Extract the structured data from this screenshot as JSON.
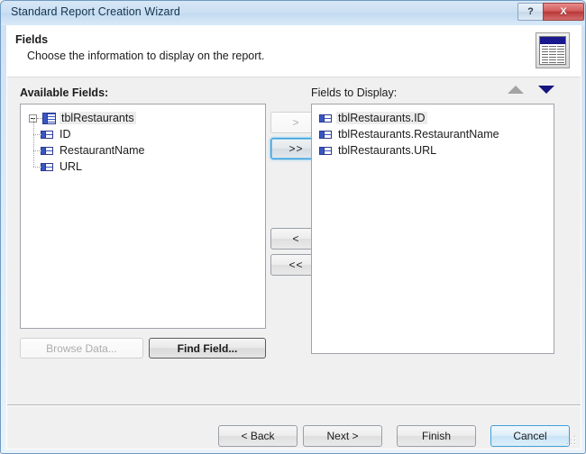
{
  "window": {
    "title": "Standard Report Creation Wizard",
    "help_button": "?",
    "close_button": "X"
  },
  "banner": {
    "title": "Fields",
    "subtitle": "Choose the information to display on the report.",
    "icon": "report-table-icon"
  },
  "available_fields": {
    "label": "Available Fields:",
    "tree": {
      "root": {
        "label": "tblRestaurants",
        "icon": "database-table-icon",
        "expander": "minus",
        "selected": true
      },
      "children": [
        {
          "label": "ID",
          "icon": "field-icon"
        },
        {
          "label": "RestaurantName",
          "icon": "field-icon"
        },
        {
          "label": "URL",
          "icon": "field-icon"
        }
      ]
    },
    "browse_data_button": "Browse Data...",
    "find_field_button": "Find Field..."
  },
  "move_buttons": [
    {
      "label": ">",
      "name": "move-right-button",
      "state": "disabled"
    },
    {
      "label": ">>",
      "name": "move-all-right-button",
      "state": "focused"
    },
    {
      "label": "<",
      "name": "move-left-button",
      "state": "normal"
    },
    {
      "label": "<<",
      "name": "move-all-left-button",
      "state": "normal"
    }
  ],
  "fields_to_display": {
    "label": "Fields to Display:",
    "sort_up": "arrow-up-icon",
    "sort_down": "arrow-down-icon",
    "items": [
      {
        "label": "tblRestaurants.ID",
        "icon": "field-icon",
        "selected": true
      },
      {
        "label": "tblRestaurants.RestaurantName",
        "icon": "field-icon",
        "selected": false
      },
      {
        "label": "tblRestaurants.URL",
        "icon": "field-icon",
        "selected": false
      }
    ]
  },
  "footer": {
    "back": "< Back",
    "next": "Next >",
    "finish": "Finish",
    "cancel": "Cancel"
  },
  "colors": {
    "accent_blue": "#14157e",
    "close_red": "#b83838",
    "focus_blue": "#3c9fdc",
    "titlebar": "#cbdff2"
  }
}
